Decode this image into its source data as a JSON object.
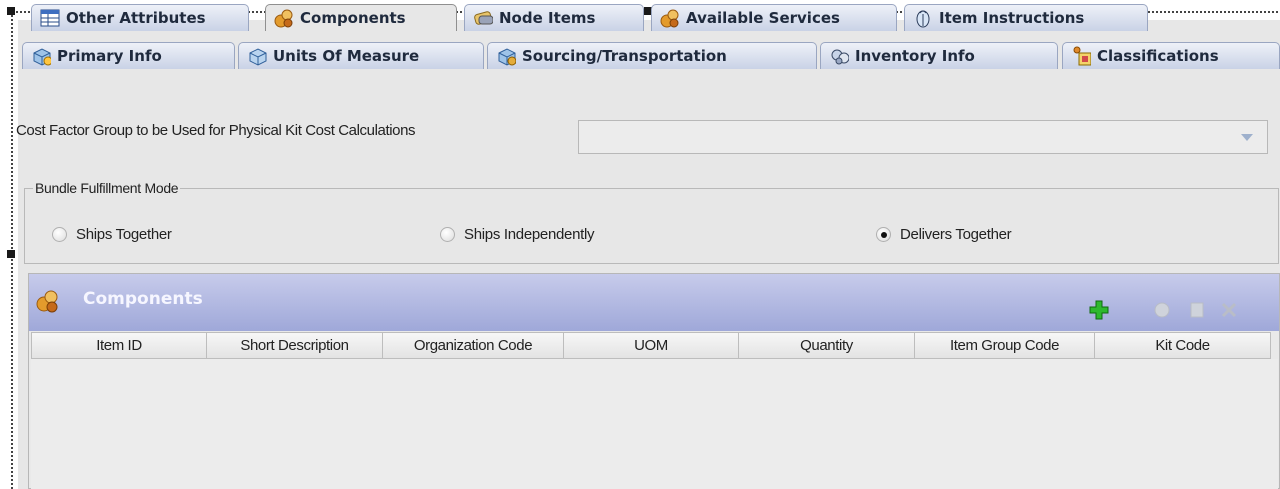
{
  "tabs_row1": [
    {
      "label": "Other Attributes",
      "icon": "table-icon"
    },
    {
      "label": "Components",
      "icon": "components-icon",
      "active": true
    },
    {
      "label": "Node Items",
      "icon": "node-items-icon"
    },
    {
      "label": "Available Services",
      "icon": "services-icon"
    },
    {
      "label": "Item Instructions",
      "icon": "instructions-icon"
    }
  ],
  "tabs_row2": [
    {
      "label": "Primary Info",
      "icon": "primary-info-icon"
    },
    {
      "label": "Units Of Measure",
      "icon": "units-icon"
    },
    {
      "label": "Sourcing/Transportation",
      "icon": "sourcing-icon"
    },
    {
      "label": "Inventory Info",
      "icon": "inventory-icon"
    },
    {
      "label": "Classifications",
      "icon": "classifications-icon"
    }
  ],
  "cost_factor": {
    "label": "Cost Factor Group to be Used for Physical Kit Cost Calculations",
    "value": ""
  },
  "bundle": {
    "legend": "Bundle Fulfillment Mode",
    "options": [
      {
        "label": "Ships Together",
        "selected": false
      },
      {
        "label": "Ships Independently",
        "selected": false
      },
      {
        "label": "Delivers Together",
        "selected": true
      }
    ]
  },
  "components": {
    "title": "Components",
    "toolbar": [
      "add-icon",
      "detail-icon",
      "edit-icon",
      "delete-icon"
    ],
    "columns": [
      "Item ID",
      "Short Description",
      "Organization Code",
      "UOM",
      "Quantity",
      "Item Group Code",
      "Kit Code"
    ],
    "rows": []
  },
  "colors": {
    "panel_bg": "#e7e7e7",
    "header_gradient_top": "#c7cbeb",
    "header_gradient_bottom": "#9fa8d9",
    "add_green": "#2eb82e"
  }
}
